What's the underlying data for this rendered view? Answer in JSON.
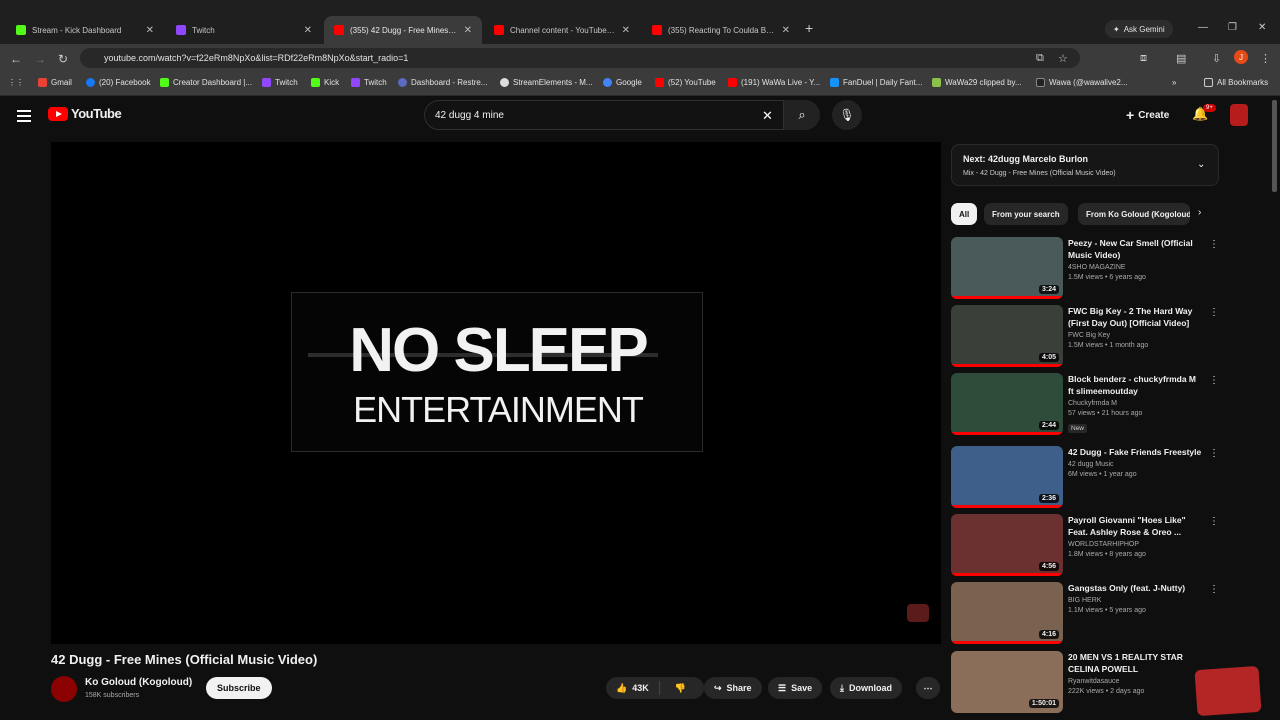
{
  "browser": {
    "tabs": [
      {
        "title": "Stream - Kick Dashboard",
        "color": "#53fc18"
      },
      {
        "title": "Twitch",
        "color": "#9146ff"
      },
      {
        "title": "(355) 42 Dugg - Free Mines (Off",
        "color": "#ff0000"
      },
      {
        "title": "Channel content - YouTube Stu",
        "color": "#ff0000"
      },
      {
        "title": "(355) Reacting To Coulda Been",
        "color": "#ff0000"
      }
    ],
    "gemini": "Ask Gemini",
    "url": "youtube.com/watch?v=f22eRm8NpXo&list=RDf22eRm8NpXo&start_radio=1",
    "profile_letter": "J",
    "bookmarks": [
      "Gmail",
      "(20) Facebook",
      "Creator Dashboard |...",
      "Twitch",
      "Kick",
      "Twitch",
      "Dashboard - Restre...",
      "StreamElements - M...",
      "Google",
      "(52) YouTube",
      "(191) WaWa Live - Y...",
      "FanDuel | Daily Fant...",
      "WaWa29 clipped by...",
      "Wawa (@wawalive2...",
      "All Bookmarks"
    ]
  },
  "yt": {
    "logo": "YouTube",
    "search_value": "42 dugg 4 mine",
    "create": "Create",
    "notif_badge": "9+"
  },
  "video": {
    "overlay_top": "NO SLEEP",
    "overlay_bottom": "ENTERTAINMENT",
    "title": "42 Dugg - Free Mines (Official Music Video)",
    "channel": "Ko Goloud (Kogoloud)",
    "subs": "158K subscribers",
    "subscribe": "Subscribe",
    "likes": "43K",
    "share": "Share",
    "save": "Save",
    "download": "Download"
  },
  "up_next": {
    "title": "Next: 42dugg Marcelo Burlon",
    "subtitle": "Mix - 42 Dugg - Free Mines (Official Music Video)"
  },
  "chips": [
    "All",
    "From your search",
    "From Ko Goloud (Kogoloud)"
  ],
  "recs": [
    {
      "title": "Peezy - New Car Smell (Official Music Video)",
      "channel": "4SHO MAGAZINE",
      "meta": "1.5M views • 6 years ago",
      "dur": "3:24",
      "thumb": "#4a5a5a"
    },
    {
      "title": "FWC Big Key - 2 The Hard Way (First Day Out) [Official Video]",
      "channel": "FWC Big Key",
      "meta": "1.5M views • 1 month ago",
      "dur": "4:05",
      "thumb": "#3a3f3a"
    },
    {
      "title": "Block benderz - chuckyfrmda M ft slimeemoutday",
      "channel": "Chuckyfrmda M",
      "meta": "57 views • 21 hours ago",
      "dur": "2:44",
      "thumb": "#2f4c3a",
      "new": "New"
    },
    {
      "title": "42 Dugg - Fake Friends Freestyle",
      "channel": "42 dugg Music",
      "meta": "6M views • 1 year ago",
      "dur": "2:36",
      "thumb": "#3d5f8a"
    },
    {
      "title": "Payroll Giovanni \"Hoes Like\" Feat. Ashley Rose & Oreo ...",
      "channel": "WORLDSTARHIPHOP",
      "meta": "1.8M views • 8 years ago",
      "dur": "4:56",
      "thumb": "#6b3030"
    },
    {
      "title": "Gangstas Only (feat. J-Nutty)",
      "channel": "BIG HERK",
      "meta": "1.1M views • 5 years ago",
      "dur": "4:16",
      "thumb": "#7a6250"
    },
    {
      "title": "20 MEN VS 1 REALITY STAR CELINA POWELL",
      "channel": "Ryanwitdasauce",
      "meta": "222K views • 2 days ago",
      "dur": "1:50:01",
      "thumb": "#8a6e5a"
    }
  ]
}
